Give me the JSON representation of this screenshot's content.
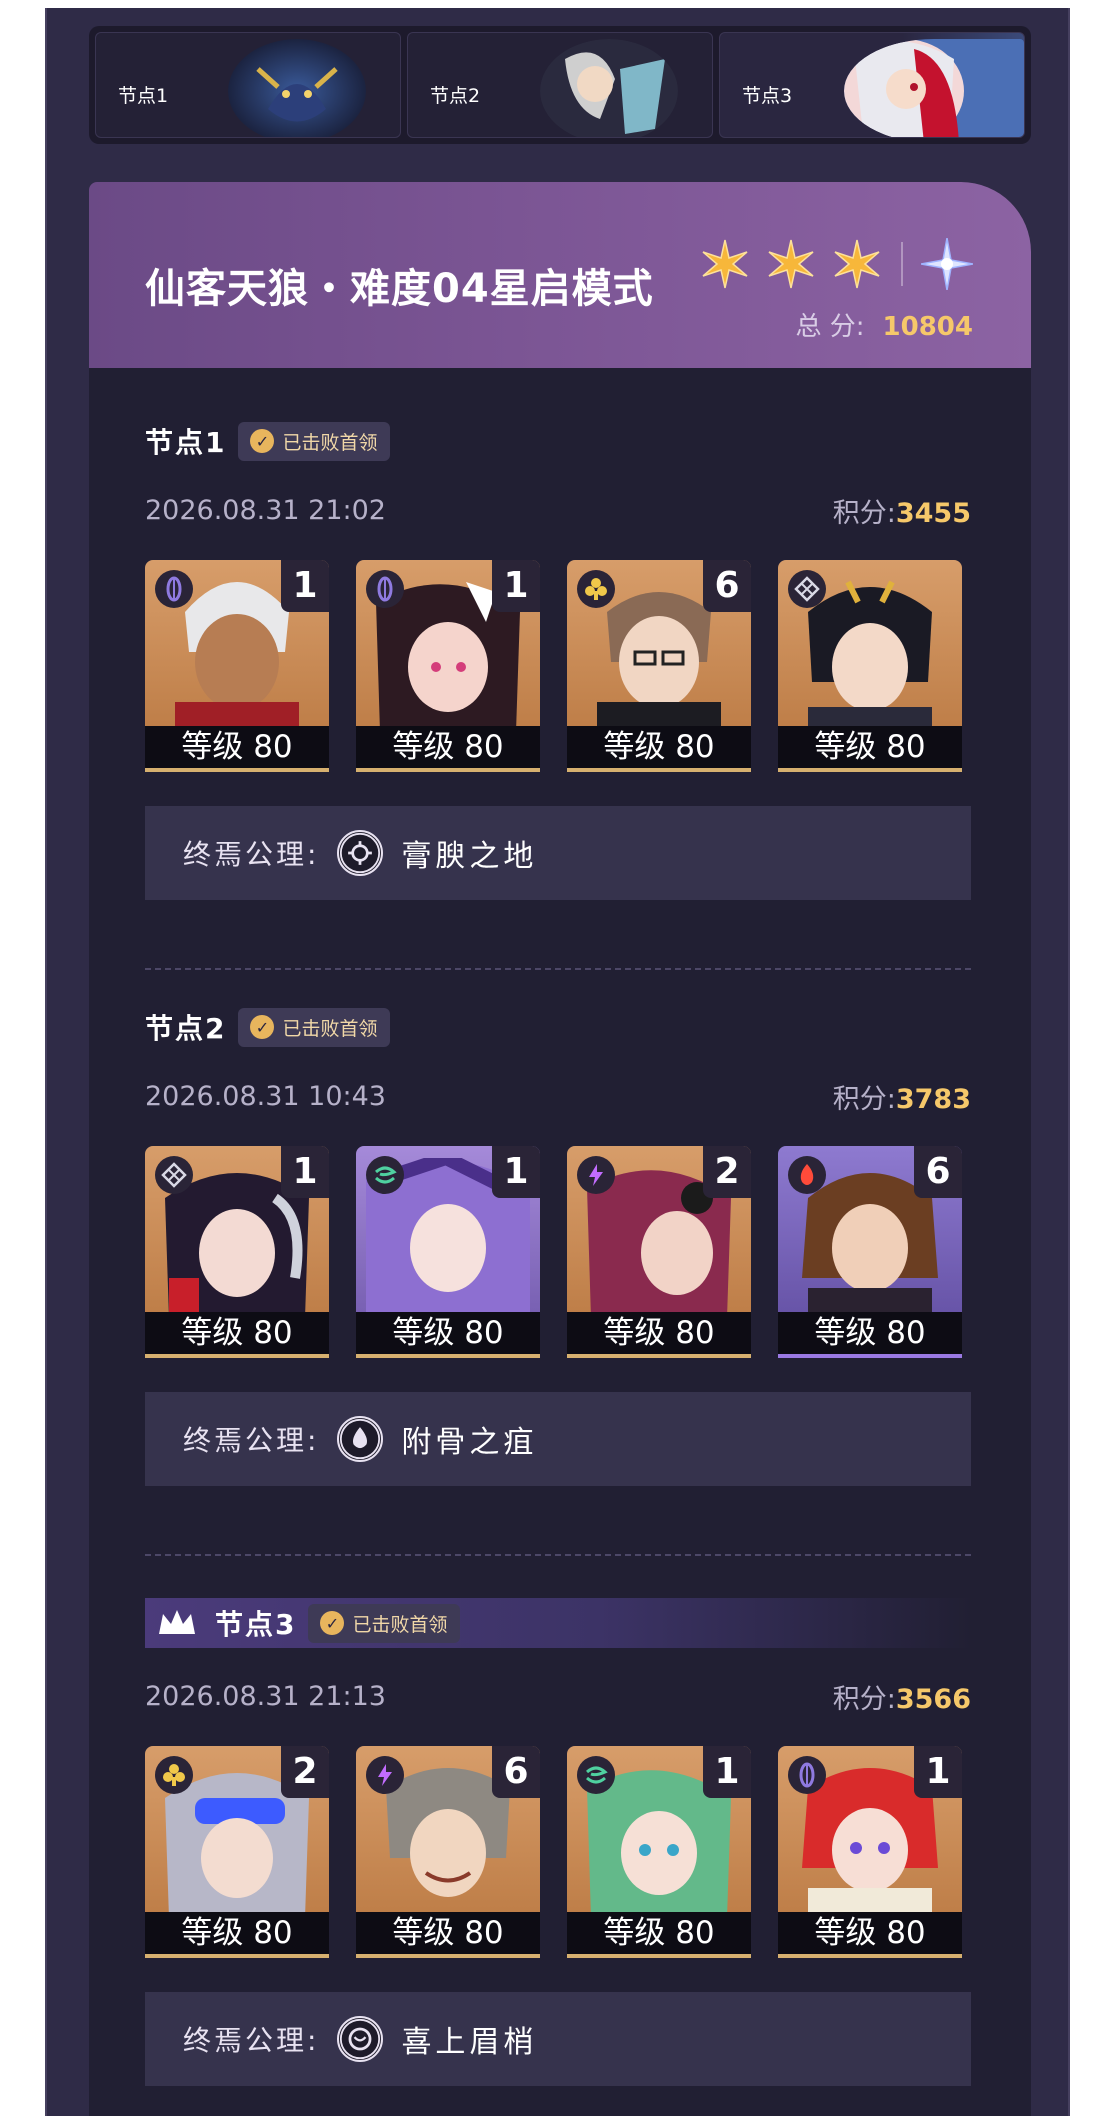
{
  "tabs": [
    {
      "label": "节点1"
    },
    {
      "label": "节点2"
    },
    {
      "label": "节点3"
    }
  ],
  "header": {
    "title": "仙客天狼・难度04星启模式",
    "total_label": "总 分:",
    "total_score": "10804"
  },
  "nodes": [
    {
      "label": "节点1",
      "badge": "已击败首领",
      "date": "2026.08.31 21:02",
      "score_label": "积分:",
      "score": "3455",
      "characters": [
        {
          "eidolon": "1",
          "level": "等级 80",
          "element": "quantum"
        },
        {
          "eidolon": "1",
          "level": "等级 80",
          "element": "quantum"
        },
        {
          "eidolon": "6",
          "level": "等级 80",
          "element": "abundance"
        },
        {
          "eidolon": "",
          "level": "等级 80",
          "element": "remembrance"
        }
      ],
      "axiom_label": "终焉公理:",
      "axiom_name": "膏腴之地"
    },
    {
      "label": "节点2",
      "badge": "已击败首领",
      "date": "2026.08.31 10:43",
      "score_label": "积分:",
      "score": "3783",
      "characters": [
        {
          "eidolon": "1",
          "level": "等级 80",
          "element": "remembrance"
        },
        {
          "eidolon": "1",
          "level": "等级 80",
          "element": "wind"
        },
        {
          "eidolon": "2",
          "level": "等级 80",
          "element": "lightning"
        },
        {
          "eidolon": "6",
          "level": "等级 80",
          "element": "fire"
        }
      ],
      "axiom_label": "终焉公理:",
      "axiom_name": "附骨之疽"
    },
    {
      "label": "节点3",
      "badge": "已击败首领",
      "date": "2026.08.31 21:13",
      "score_label": "积分:",
      "score": "3566",
      "characters": [
        {
          "eidolon": "2",
          "level": "等级 80",
          "element": "abundance"
        },
        {
          "eidolon": "6",
          "level": "等级 80",
          "element": "lightning"
        },
        {
          "eidolon": "1",
          "level": "等级 80",
          "element": "wind"
        },
        {
          "eidolon": "1",
          "level": "等级 80",
          "element": "quantum"
        }
      ],
      "axiom_label": "终焉公理:",
      "axiom_name": "喜上眉梢"
    }
  ],
  "colors": {
    "accent_gold": "#f6c86a",
    "header_purple": "#7b5594",
    "background": "#211f33"
  }
}
